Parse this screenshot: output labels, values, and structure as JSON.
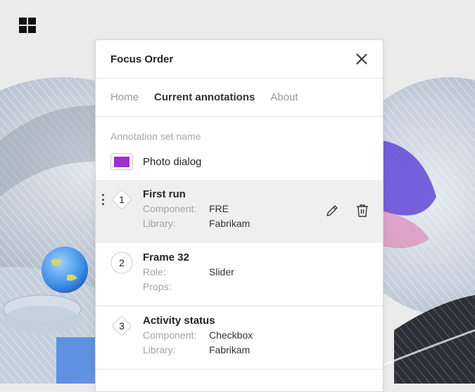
{
  "panel": {
    "title": "Focus Order",
    "tabs": [
      {
        "label": "Home",
        "active": false
      },
      {
        "label": "Current annotations",
        "active": true
      },
      {
        "label": "About",
        "active": false
      }
    ],
    "set_label": "Annotation set name",
    "set_color": "#9e2fd0",
    "set_name": "Photo dialog",
    "items": [
      {
        "num": "1",
        "title": "First run",
        "shape": "diamond",
        "props": [
          {
            "k": "Component:",
            "v": "FRE"
          },
          {
            "k": "Library:",
            "v": "Fabrikam"
          }
        ]
      },
      {
        "num": "2",
        "title": "Frame 32",
        "shape": "circle",
        "props": [
          {
            "k": "Role:",
            "v": "Slider"
          },
          {
            "k": "Props:",
            "v": ""
          }
        ]
      },
      {
        "num": "3",
        "title": "Activity status",
        "shape": "diamond",
        "props": [
          {
            "k": "Component:",
            "v": "Checkbox"
          },
          {
            "k": "Library:",
            "v": "Fabrikam"
          }
        ]
      }
    ]
  },
  "icons": {
    "logo": "windows-logo-icon",
    "close": "close-icon",
    "drag": "drag-handle-icon",
    "edit": "pencil-icon",
    "delete": "trash-icon"
  }
}
